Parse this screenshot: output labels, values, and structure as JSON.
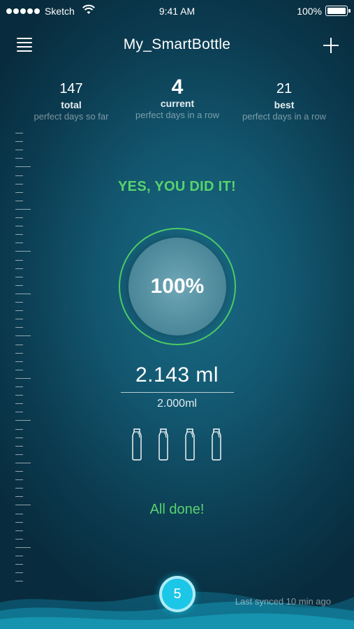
{
  "status_bar": {
    "carrier": "Sketch",
    "time": "9:41 AM",
    "battery": "100%"
  },
  "nav": {
    "title": "My_SmartBottle"
  },
  "stats": {
    "total": {
      "value": "147",
      "label": "total",
      "sub": "perfect days so far"
    },
    "current": {
      "value": "4",
      "label": "current",
      "sub": "perfect days in a row"
    },
    "best": {
      "value": "21",
      "label": "best",
      "sub": "perfect days in a row"
    }
  },
  "main": {
    "success_message": "YES, YOU DID IT!",
    "progress_percent": "100%",
    "progress_value": 1.0,
    "volume": "2.143 ml",
    "goal": "2.000ml",
    "bottles_count": 4,
    "done_message": "All done!"
  },
  "footer": {
    "day_badge": "5",
    "sync_status": "Last synced 10 min ago"
  },
  "colors": {
    "accent_green": "#58d36d",
    "badge_cyan": "#1cc6e6",
    "background": "#12566e"
  },
  "icons": [
    "signal-dots",
    "wifi-icon",
    "battery-icon",
    "menu-icon",
    "plus-icon",
    "bottle-icon"
  ]
}
